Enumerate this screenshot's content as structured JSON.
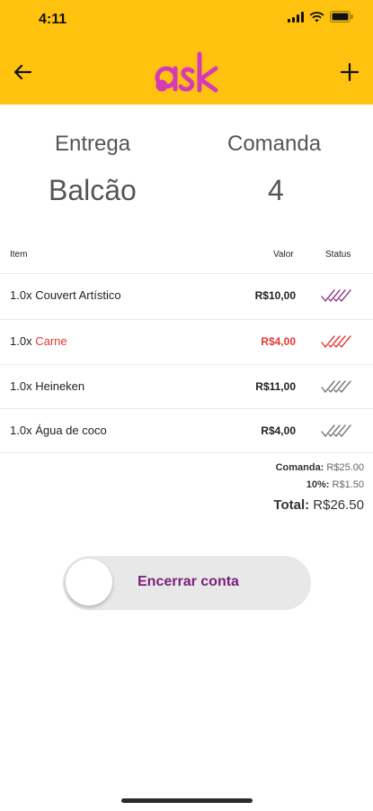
{
  "status_bar": {
    "time": "4:11"
  },
  "header": {
    "logo_text": "ask",
    "brand_color": "#FFC20E",
    "logo_color": "#D63BB7"
  },
  "info": {
    "delivery_label": "Entrega",
    "delivery_value": "Balcão",
    "order_label": "Comanda",
    "order_value": "4"
  },
  "table": {
    "columns": [
      "Item",
      "Valor",
      "Status"
    ],
    "rows": [
      {
        "qty": "1.0x",
        "name": "Couvert Artístico",
        "value": "R$10,00",
        "status_color": "#8E3A8E",
        "highlight": false
      },
      {
        "qty": "1.0x",
        "name": "Carne",
        "value": "R$4,00",
        "status_color": "#E53935",
        "highlight": true
      },
      {
        "qty": "1.0x",
        "name": "Heineken",
        "value": "R$11,00",
        "status_color": "#777777",
        "highlight": false
      },
      {
        "qty": "1.0x",
        "name": "Água de coco",
        "value": "R$4,00",
        "status_color": "#777777",
        "highlight": false
      }
    ]
  },
  "totals": {
    "comanda_label": "Comanda:",
    "comanda_value": "R$25.00",
    "service_label": "10%:",
    "service_value": "R$1.50",
    "total_label": "Total:",
    "total_value": "R$26.50"
  },
  "action": {
    "label": "Encerrar conta",
    "on": false
  }
}
